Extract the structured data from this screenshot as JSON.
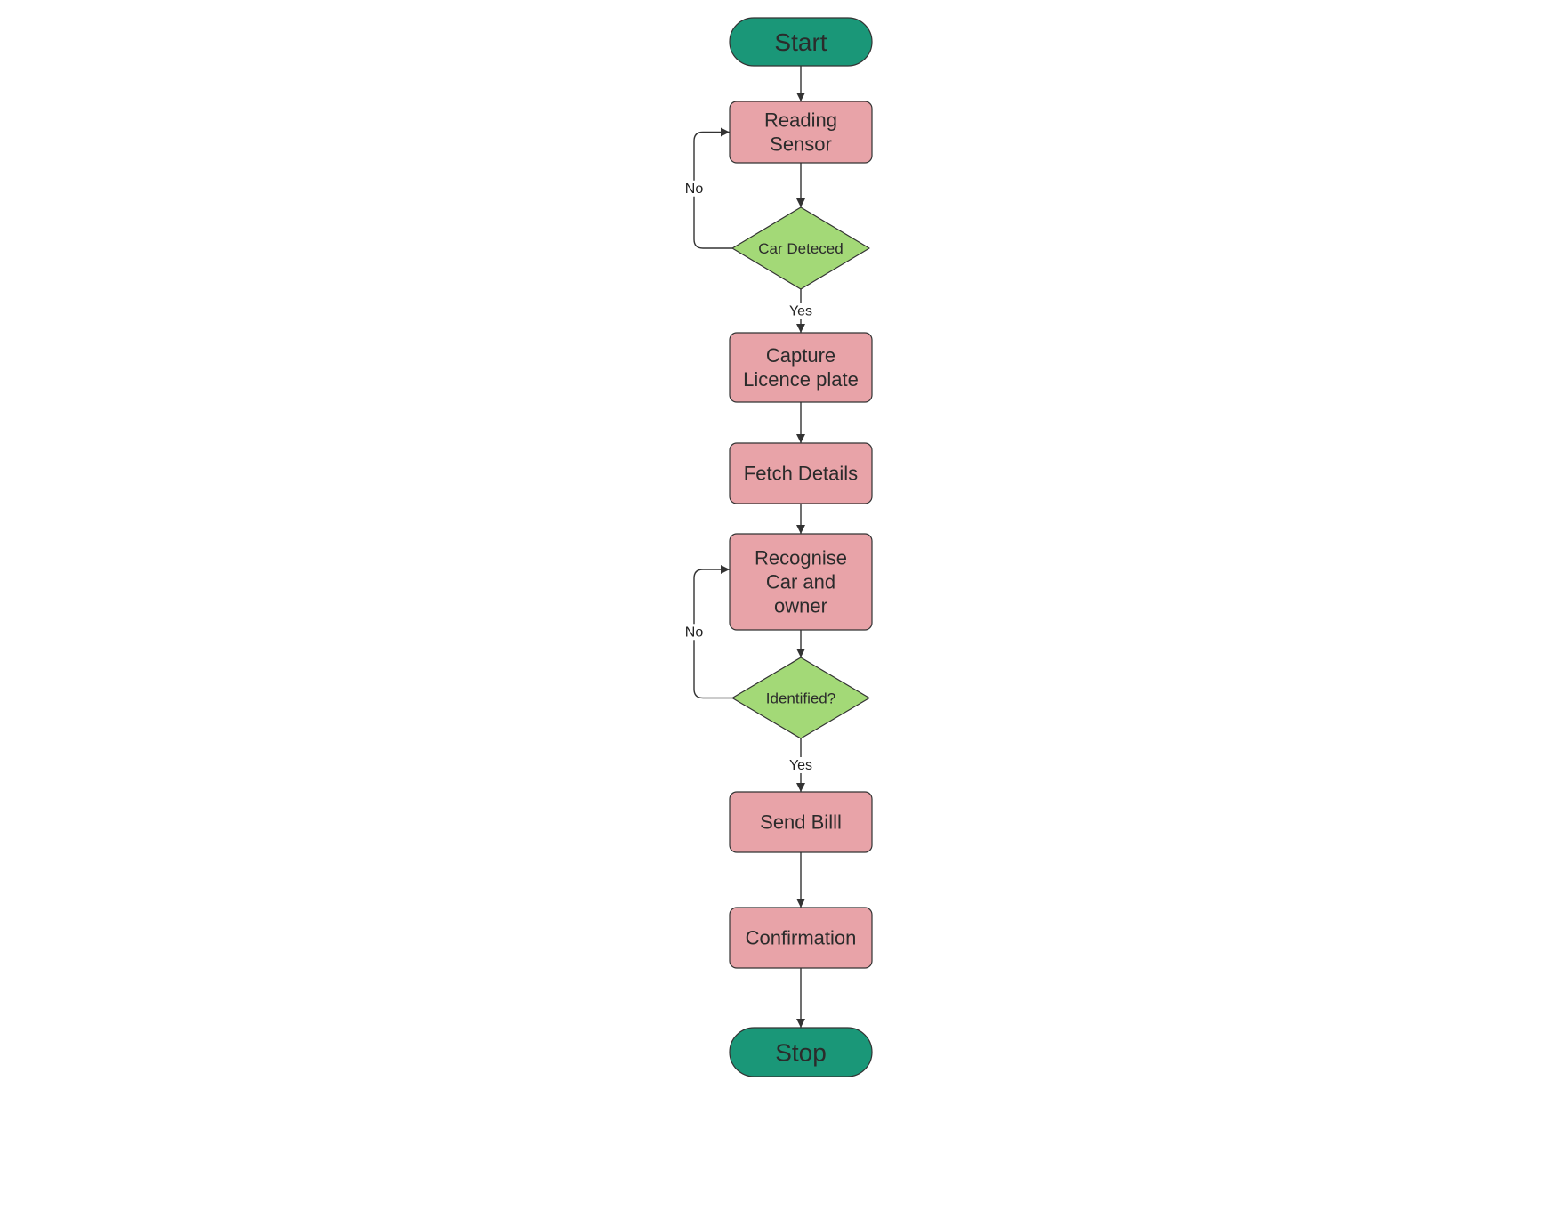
{
  "diagram": {
    "type": "flowchart",
    "colors": {
      "terminal": "#1a9778",
      "process": "#e8a3a8",
      "decision": "#a3d977",
      "stroke": "#333333",
      "text": "#2b2b2b"
    },
    "nodes": [
      {
        "id": "start",
        "kind": "terminal",
        "lines": [
          "Start"
        ]
      },
      {
        "id": "reading-sensor",
        "kind": "process",
        "lines": [
          "Reading",
          "Sensor"
        ]
      },
      {
        "id": "car-detected",
        "kind": "decision",
        "lines": [
          "Car Deteced"
        ]
      },
      {
        "id": "capture-plate",
        "kind": "process",
        "lines": [
          "Capture",
          "Licence plate"
        ]
      },
      {
        "id": "fetch-details",
        "kind": "process",
        "lines": [
          "Fetch Details"
        ]
      },
      {
        "id": "recognise-car",
        "kind": "process",
        "lines": [
          "Recognise",
          "Car and",
          "owner"
        ]
      },
      {
        "id": "identified",
        "kind": "decision",
        "lines": [
          "Identified?"
        ]
      },
      {
        "id": "send-bill",
        "kind": "process",
        "lines": [
          "Send Billl"
        ]
      },
      {
        "id": "confirmation",
        "kind": "process",
        "lines": [
          "Confirmation"
        ]
      },
      {
        "id": "stop",
        "kind": "terminal",
        "lines": [
          "Stop"
        ]
      }
    ],
    "edges": [
      {
        "from": "start",
        "to": "reading-sensor",
        "label": ""
      },
      {
        "from": "reading-sensor",
        "to": "car-detected",
        "label": ""
      },
      {
        "from": "car-detected",
        "to": "reading-sensor",
        "label": "No"
      },
      {
        "from": "car-detected",
        "to": "capture-plate",
        "label": "Yes"
      },
      {
        "from": "capture-plate",
        "to": "fetch-details",
        "label": ""
      },
      {
        "from": "fetch-details",
        "to": "recognise-car",
        "label": ""
      },
      {
        "from": "recognise-car",
        "to": "identified",
        "label": ""
      },
      {
        "from": "identified",
        "to": "recognise-car",
        "label": "No"
      },
      {
        "from": "identified",
        "to": "send-bill",
        "label": "Yes"
      },
      {
        "from": "send-bill",
        "to": "confirmation",
        "label": ""
      },
      {
        "from": "confirmation",
        "to": "stop",
        "label": ""
      }
    ]
  }
}
